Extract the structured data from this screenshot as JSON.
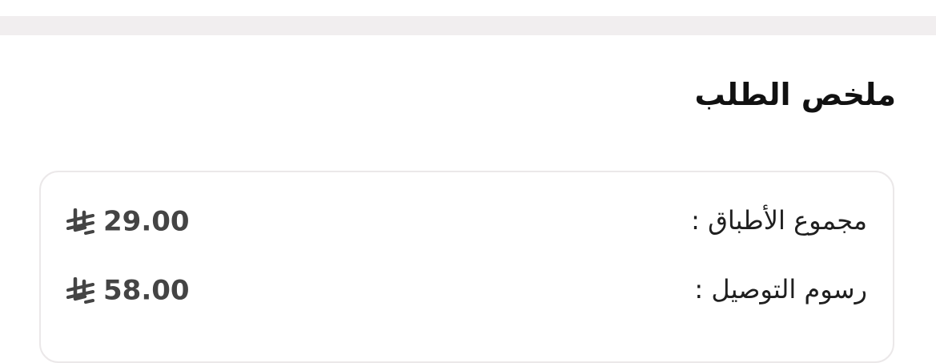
{
  "summary": {
    "title": "ملخص الطلب",
    "rows": [
      {
        "label": "مجموع الأطباق :",
        "amount": "29.00",
        "currency_icon": "saudi-riyal-icon"
      },
      {
        "label": "رسوم التوصيل :",
        "amount": "58.00",
        "currency_icon": "saudi-riyal-icon"
      }
    ]
  },
  "colors": {
    "divider": "#f1eeef",
    "card_border": "#ebe8e9",
    "amount_text": "#444444",
    "title_text": "#111111"
  }
}
